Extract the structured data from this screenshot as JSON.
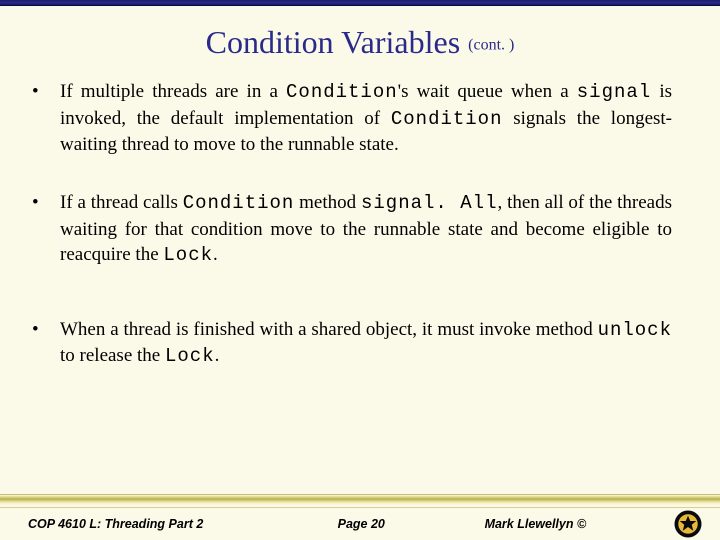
{
  "title": "Condition Variables",
  "title_suffix": "(cont. )",
  "bullets": [
    {
      "pre1": "If multiple threads are in a ",
      "code1": "Condition",
      "mid1": "'s wait queue when a ",
      "code2": "signal",
      "mid2": " is invoked, the default implementation of ",
      "code3": "Condition",
      "post": " signals the longest-waiting thread to move to the runnable state."
    },
    {
      "pre1": "If a thread calls ",
      "code1": "Condition",
      "mid1": " method ",
      "code2": "signal. All",
      "mid2": ", then all of the threads waiting for that condition move to the runnable state and become eligible to reacquire the ",
      "code3": "Lock",
      "post": "."
    },
    {
      "pre1": "When a thread is finished with a shared object, it must invoke method ",
      "code1": "unlock",
      "mid1": " to release the ",
      "code2": "Lock",
      "mid2": "",
      "code3": "",
      "post": "."
    }
  ],
  "footer": {
    "left": "COP 4610 L: Threading Part 2",
    "center": "Page 20",
    "right": "Mark Llewellyn ©"
  }
}
